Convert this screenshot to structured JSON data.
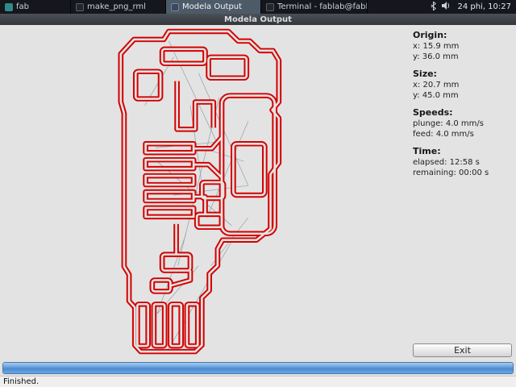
{
  "taskbar": {
    "items": [
      {
        "label": "fab"
      },
      {
        "label": "make_png_rml"
      },
      {
        "label": "Modela Output"
      },
      {
        "label": "Terminal - fablab@fablab..."
      }
    ],
    "clock": "24 phi, 10:27"
  },
  "window": {
    "title": "Modela Output"
  },
  "sidebar": {
    "origin": {
      "heading": "Origin:",
      "x": "x: 15.9 mm",
      "y": "y: 36.0 mm"
    },
    "size": {
      "heading": "Size:",
      "x": "x: 20.7 mm",
      "y": "y: 45.0 mm"
    },
    "speeds": {
      "heading": "Speeds:",
      "plunge": "plunge: 4.0 mm/s",
      "feed": "feed: 4.0 mm/s"
    },
    "time": {
      "heading": "Time:",
      "elapsed": "elapsed: 12:58 s",
      "remaining": "remaining: 00:00 s"
    },
    "exit_label": "Exit"
  },
  "progress": {
    "percent": 100
  },
  "status": {
    "message": "Finished."
  },
  "colors": {
    "toolpath": "#d40000",
    "travel": "#93a1ad",
    "progress_blue": "#4c8bd0"
  }
}
